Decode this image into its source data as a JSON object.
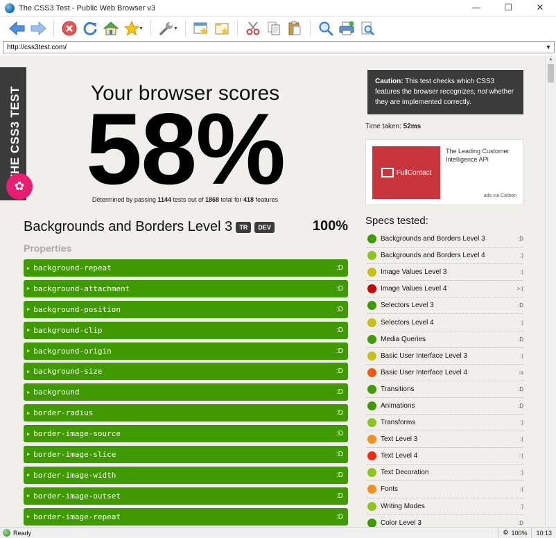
{
  "window": {
    "title": "The CSS3 Test - Public Web Browser v3",
    "minimize": "—",
    "maximize": "☐",
    "close": "✕"
  },
  "address": {
    "url": "http://css3test.com/"
  },
  "ribbon": {
    "text": "THE CSS3 TEST"
  },
  "score": {
    "heading": "Your browser scores",
    "percent": "58%",
    "sub_prefix": "Determined by passing ",
    "passed": "1144",
    "sub_mid1": " tests out of ",
    "total": "1868",
    "sub_mid2": " total for ",
    "features": "418",
    "sub_suffix": " features"
  },
  "current_spec": {
    "title": "Backgrounds and Borders Level 3",
    "tags": [
      "TR",
      "DEV"
    ],
    "score": "100%",
    "properties_label": "Properties",
    "tests": [
      {
        "name": "background-repeat",
        "result": ":D"
      },
      {
        "name": "background-attachment",
        "result": ":D"
      },
      {
        "name": "background-position",
        "result": ":D"
      },
      {
        "name": "background-clip",
        "result": ":D"
      },
      {
        "name": "background-origin",
        "result": ":D"
      },
      {
        "name": "background-size",
        "result": ":D"
      },
      {
        "name": "background",
        "result": ":D"
      },
      {
        "name": "border-radius",
        "result": ":D"
      },
      {
        "name": "border-image-source",
        "result": ":D"
      },
      {
        "name": "border-image-slice",
        "result": ":D"
      },
      {
        "name": "border-image-width",
        "result": ":D"
      },
      {
        "name": "border-image-outset",
        "result": ":D"
      },
      {
        "name": "border-image-repeat",
        "result": ":D"
      }
    ]
  },
  "caution": {
    "label": "Caution:",
    "text1": " This test checks which CSS3 features the browser recognizes, ",
    "not": "not",
    "text2": " whether they are implemented correctly."
  },
  "time": {
    "label": "Time taken: ",
    "value": "52ms"
  },
  "ad": {
    "brand": "FullContact",
    "text": "The Leading Customer Intelligence API",
    "via": "ads via Carbon"
  },
  "specs": {
    "title": "Specs tested:",
    "items": [
      {
        "name": "Backgrounds and Borders Level 3",
        "face": ":D",
        "color": "#3f9a00"
      },
      {
        "name": "Backgrounds and Borders Level 4",
        "face": ":)",
        "color": "#8fc31f"
      },
      {
        "name": "Image Values Level 3",
        "face": ":|",
        "color": "#c5c11a"
      },
      {
        "name": "Image Values Level 4",
        "face": ">:(",
        "color": "#c0080a"
      },
      {
        "name": "Selectors Level 3",
        "face": ":D",
        "color": "#3f9a00"
      },
      {
        "name": "Selectors Level 4",
        "face": ":|",
        "color": "#c5c11a"
      },
      {
        "name": "Media Queries",
        "face": ":D",
        "color": "#3f9a00"
      },
      {
        "name": "Basic User Interface Level 3",
        "face": ":|",
        "color": "#c5c11a"
      },
      {
        "name": "Basic User Interface Level 4",
        "face": ":o",
        "color": "#f05a12"
      },
      {
        "name": "Transitions",
        "face": ":D",
        "color": "#3f9a00"
      },
      {
        "name": "Animations",
        "face": ":D",
        "color": "#3f9a00"
      },
      {
        "name": "Transforms",
        "face": ":)",
        "color": "#8fc31f"
      },
      {
        "name": "Text Level 3",
        "face": ":(",
        "color": "#f39120"
      },
      {
        "name": "Text Level 4",
        "face": ":'(",
        "color": "#f02b12"
      },
      {
        "name": "Text Decoration",
        "face": ":)",
        "color": "#8fc31f"
      },
      {
        "name": "Fonts",
        "face": ":(",
        "color": "#f39120"
      },
      {
        "name": "Writing Modes",
        "face": ":)",
        "color": "#8fc31f"
      },
      {
        "name": "Color Level 3",
        "face": ":D",
        "color": "#3f9a00"
      }
    ]
  },
  "status": {
    "ready": "Ready",
    "zoom": "100%",
    "time": "10:13"
  }
}
